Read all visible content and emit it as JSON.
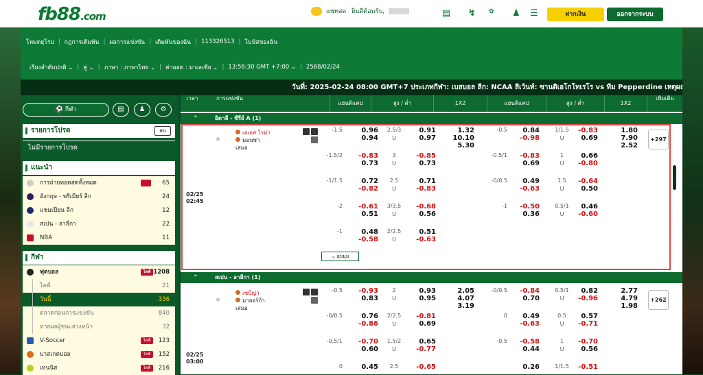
{
  "header": {
    "logo_main": "fb88",
    "logo_tld": ".com",
    "chat": "แชทสด",
    "welcome": "ยินดีต้อนรับ,",
    "deposit": "ฝากเงิน",
    "logout": "ออกจากระบบ"
  },
  "menu": {
    "items": [
      "โหมดยุโรป",
      "กฎการเดิมพัน",
      "ผลการแข่งขัน",
      "เดิมพันของฉัน",
      "113326513",
      "โบนัสของฉัน"
    ],
    "odds_order": "เรียงลำดับปกติ",
    "pair": "คู่",
    "language": "ภาษา : ภาษาไทย",
    "odds_type": "ค่าออด : มาเลเซีย",
    "clock": "13:56:30 GMT +7:00",
    "date": "2568/02/24"
  },
  "ticker": "วันที่: 2025-02-24 08:00 GMT+7 ประเภทกีฬา: เบสบอล ลีก: NCAA ลีเว้นท์: ซานดิเอโกโทเรโร vs ทีม Pepperdine เหตุผลการยกเลิก: การแข",
  "sidebar": {
    "tab_sport": "กีฬา",
    "program_title": "รายการโปรด",
    "delete": "ลบ",
    "no_program": "ไม่มีรายการโปรด",
    "rec_title": "แนะนำ",
    "rec": [
      {
        "label": "การถ่ายทอดสดทั้งหมด",
        "count": "65"
      },
      {
        "label": "อังกฤษ - พรีเมียร์ ลีก",
        "count": "24"
      },
      {
        "label": "แชมเปียน ลีก",
        "count": "12"
      },
      {
        "label": "สเปน - ลาลีกา",
        "count": "22"
      },
      {
        "label": "NBA",
        "count": "11"
      }
    ],
    "sport_title": "กีฬา",
    "sports": [
      {
        "label": "ฟุตบอล",
        "count": "1208"
      },
      {
        "label": "ไลฟ์",
        "count": "21"
      },
      {
        "label": "วันนี้",
        "count": "336"
      },
      {
        "label": "ตลาดก่อนการแข่งขัน",
        "count": "840"
      },
      {
        "label": "ทายผลผู้ชนะล่วงหน้า",
        "count": "32"
      },
      {
        "label": "V-Soccer",
        "count": "123"
      },
      {
        "label": "บาสเกตบอล",
        "count": "152"
      },
      {
        "label": "เทนนิส",
        "count": "216"
      }
    ],
    "live_badge": "ไลฟ์"
  },
  "columns": {
    "time": "เวลา",
    "event": "การแข่งขัน",
    "hdp": "แฮนดิแคป",
    "ou": "สูง / ต่ำ",
    "x12": "1X2",
    "hdp2": "แฮนดิแคป",
    "ou2": "สูง / ต่ำ",
    "x12b": "1X2",
    "more": "เพิ่มเติม"
  },
  "league1": {
    "name": "อิตาลี - ซีรีย์ A (1)",
    "date": "02/25",
    "time": "02:45",
    "home": "เอเอส โรม่า",
    "away": "มอนซ่า",
    "draw": "เสมอ",
    "more": "+297",
    "collapse": "ยุบมุม",
    "rows": [
      {
        "h": "-1.5",
        "o1": "0.96",
        "o2": "0.94",
        "ou": "2.5/3",
        "u": "U",
        "p1": "0.91",
        "p2": "0.97",
        "x1": "1.32",
        "x2": "10.10",
        "x3": "5.30",
        "h2": "-0.5",
        "q1": "0.84",
        "q2": "-0.98",
        "ou2": "1/1.5",
        "r1": "-0.83",
        "r2": "0.69",
        "y1": "1.80",
        "y2": "7.90",
        "y3": "2.52"
      },
      {
        "h": "-1.5/2",
        "o1": "-0.83",
        "o2": "0.73",
        "ou": "3",
        "u": "U",
        "p1": "-0.85",
        "p2": "0.73",
        "h2": "-0.5/1",
        "q1": "-0.83",
        "q2": "0.69",
        "ou2": "1",
        "r1": "0.66",
        "r2": "-0.80"
      },
      {
        "h": "-1/1.5",
        "o1": "0.72",
        "o2": "-0.82",
        "ou": "2.5",
        "u": "U",
        "p1": "0.71",
        "p2": "-0.83",
        "h2": "-0/0.5",
        "q1": "0.49",
        "q2": "-0.63",
        "ou2": "1.5",
        "r1": "-0.64",
        "r2": "0.50"
      },
      {
        "h": "-2",
        "o1": "-0.61",
        "o2": "0.51",
        "ou": "3/3.5",
        "u": "U",
        "p1": "-0.68",
        "p2": "0.56",
        "h2": "-1",
        "q1": "-0.50",
        "q2": "0.36",
        "ou2": "0.5/1",
        "r1": "0.46",
        "r2": "-0.60"
      },
      {
        "h": "-1",
        "o1": "0.48",
        "o2": "-0.58",
        "ou": "2/2.5",
        "u": "U",
        "p1": "0.51",
        "p2": "-0.63"
      }
    ]
  },
  "league2": {
    "name": "สเปน - ลาลีกา (1)",
    "date": "02/25",
    "time": "03:00",
    "home": "เซบีญ่า",
    "away": "มายอร์ก้า",
    "draw": "เสมอ",
    "more": "+262",
    "rows": [
      {
        "h": "-0.5",
        "o1": "-0.93",
        "o2": "0.83",
        "ou": "2",
        "u": "U",
        "p1": "0.93",
        "p2": "0.95",
        "x1": "2.05",
        "x2": "4.07",
        "x3": "3.19",
        "h2": "-0/0.5",
        "q1": "-0.84",
        "q2": "0.70",
        "ou2": "0.5/1",
        "r1": "0.82",
        "r2": "-0.96",
        "y1": "2.77",
        "y2": "4.79",
        "y3": "1.98"
      },
      {
        "h": "-0/0.5",
        "o1": "0.76",
        "o2": "-0.86",
        "ou": "2/2.5",
        "u": "U",
        "p1": "-0.81",
        "p2": "0.69",
        "h2": "0",
        "q1": "0.49",
        "q2": "-0.63",
        "ou2": "0.5",
        "r1": "0.57",
        "r2": "-0.71"
      },
      {
        "h": "-0.5/1",
        "o1": "-0.70",
        "o2": "0.60",
        "ou": "1.5/2",
        "u": "U",
        "p1": "0.65",
        "p2": "-0.77",
        "h2": "-0.5",
        "q1": "-0.58",
        "q2": "0.44",
        "ou2": "1",
        "r1": "-0.70",
        "r2": "0.56"
      },
      {
        "h": "0",
        "o1": "0.45",
        "ou": "2.5",
        "p1": "-0.65",
        "q1": "0.26",
        "ou2": "1/1.5",
        "r1": "-0.51"
      }
    ]
  }
}
